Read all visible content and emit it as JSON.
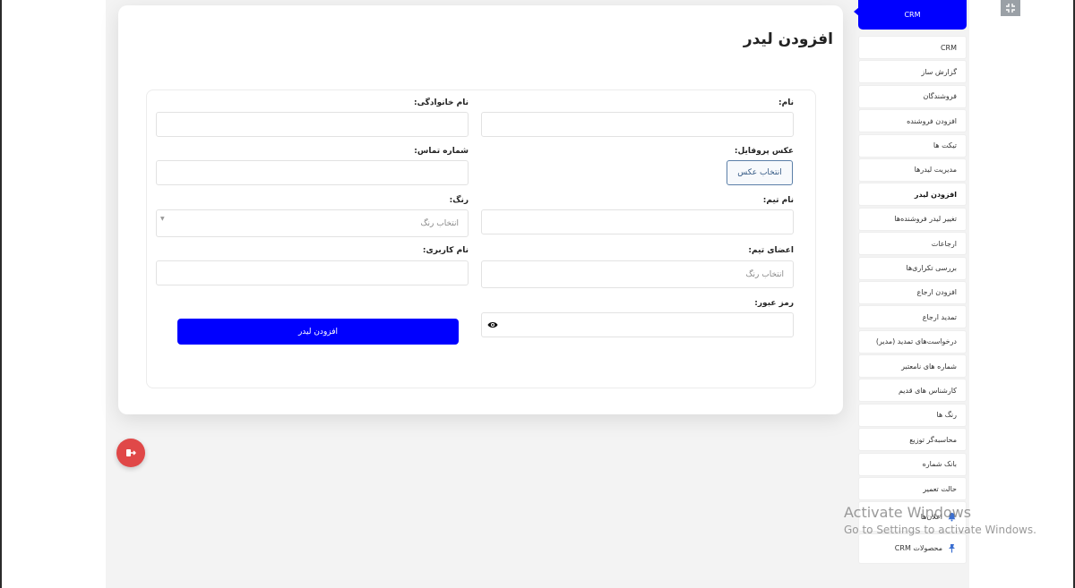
{
  "page": {
    "title": "افزودن لیدر"
  },
  "form": {
    "first_name_label": "نام:",
    "last_name_label": "نام خانوادگی:",
    "profile_photo_label": "عکس پروفایل:",
    "choose_photo_button": "انتخاب عکس",
    "phone_label": "شماره تماس:",
    "team_name_label": "نام تیم:",
    "color_label": "رنگ:",
    "color_placeholder": "انتخاب رنگ",
    "team_members_label": "اعضای تیم:",
    "team_members_placeholder": "انتخاب رنگ",
    "username_label": "نام کاربری:",
    "password_label": "رمز عبور:",
    "submit_label": "افزودن لیدر"
  },
  "sidebar": {
    "header": "CRM",
    "items": [
      {
        "label": "CRM"
      },
      {
        "label": "گزارش ساز"
      },
      {
        "label": "فروشندگان"
      },
      {
        "label": "افزودن فروشنده"
      },
      {
        "label": "تیکت ها"
      },
      {
        "label": "مدیریت لیدرها"
      },
      {
        "label": "افزودن لیدر"
      },
      {
        "label": "تغییر لیدر فروشنده‌ها"
      },
      {
        "label": "ارجاعات"
      },
      {
        "label": "بررسی تکراری‌ها"
      },
      {
        "label": "افزودن ارجاع"
      },
      {
        "label": "تمدید ارجاع"
      },
      {
        "label": "درخواست‌های تمدید (مدیر)"
      },
      {
        "label": "شماره های نامعتبر"
      },
      {
        "label": "کارشناس های قدیم"
      },
      {
        "label": "رنگ ها"
      },
      {
        "label": "محاسبه‌گر توزیع"
      },
      {
        "label": "بانک شماره"
      },
      {
        "label": "حالت تعمیر"
      },
      {
        "label": "اعلان‌ها",
        "icon": "bell-icon"
      },
      {
        "label": "محصولات CRM",
        "icon": "pin-icon"
      }
    ],
    "active_index": 6
  },
  "watermark": {
    "line1": "Activate Windows",
    "line2": "Go to Settings to activate Windows."
  },
  "colors": {
    "accent": "#0000ff",
    "logout": "#e04848"
  }
}
